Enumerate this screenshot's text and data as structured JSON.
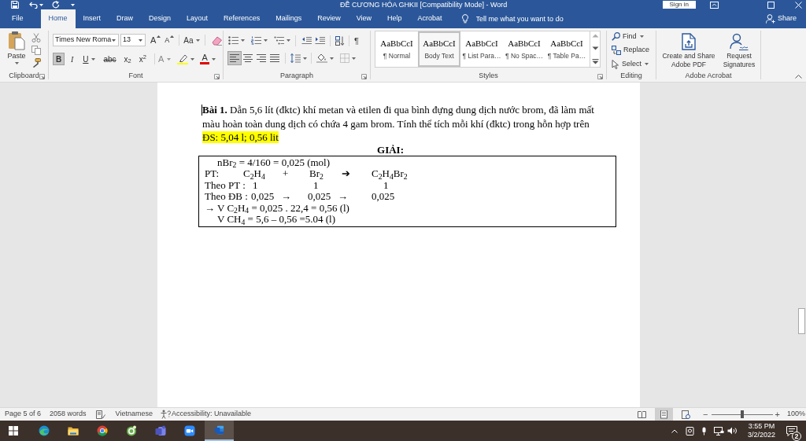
{
  "window": {
    "title": "ĐỀ CƯƠNG HÓA GHKII [Compatibility Mode] - Word",
    "sign_in": "Sign in"
  },
  "tabs": [
    {
      "label": "File",
      "selected": false
    },
    {
      "label": "Home",
      "selected": true
    },
    {
      "label": "Insert",
      "selected": false
    },
    {
      "label": "Draw",
      "selected": false
    },
    {
      "label": "Design",
      "selected": false
    },
    {
      "label": "Layout",
      "selected": false
    },
    {
      "label": "References",
      "selected": false
    },
    {
      "label": "Mailings",
      "selected": false
    },
    {
      "label": "Review",
      "selected": false
    },
    {
      "label": "View",
      "selected": false
    },
    {
      "label": "Help",
      "selected": false
    },
    {
      "label": "Acrobat",
      "selected": false
    }
  ],
  "tell_me": {
    "placeholder": "Tell me what you want to do"
  },
  "share": "Share",
  "ribbon": {
    "clipboard": {
      "paste": "Paste",
      "label": "Clipboard",
      "launcher": true
    },
    "font": {
      "name": "Times New Roma",
      "size": "13",
      "grow": "A",
      "shrink": "A",
      "change_case": "Aa",
      "formats": [
        {
          "kind": "bold",
          "label": "B",
          "selected": true,
          "dropdown": false
        },
        {
          "kind": "italic",
          "label": "I",
          "selected": false,
          "dropdown": false
        },
        {
          "kind": "underline",
          "label": "U",
          "selected": false,
          "dropdown": true
        },
        {
          "kind": "strike",
          "label": "abc",
          "selected": false,
          "dropdown": false
        },
        {
          "kind": "subscript",
          "label": "x$_{2}$",
          "selected": false,
          "dropdown": false
        },
        {
          "kind": "superscript",
          "label": "x$^{2}$",
          "selected": false,
          "dropdown": false
        }
      ],
      "effects": "A",
      "font_color": "A",
      "label": "Font",
      "launcher": true
    },
    "paragraph": {
      "alignment": [
        {
          "kind": "left",
          "selected": true
        },
        {
          "kind": "center",
          "selected": false
        },
        {
          "kind": "right",
          "selected": false
        },
        {
          "kind": "justify",
          "selected": false
        }
      ],
      "marks": "¶",
      "label": "Paragraph",
      "launcher": true
    },
    "styles": {
      "items": [
        {
          "preview": "AaBbCcI",
          "label": "¶ Normal",
          "selected": false
        },
        {
          "preview": "AaBbCcI",
          "label": "Body Text",
          "selected": true
        },
        {
          "preview": "AaBbCcI",
          "label": "¶ List Para…",
          "selected": false
        },
        {
          "preview": "AaBbCcI",
          "label": "¶ No Spac…",
          "selected": false
        },
        {
          "preview": "AaBbCcI",
          "label": "¶ Table Pa…",
          "selected": false
        }
      ],
      "label": "Styles",
      "launcher": true
    },
    "editing": {
      "items": [
        {
          "kind": "find",
          "label": "Find",
          "dropdown": true
        },
        {
          "kind": "replace",
          "label": "Replace",
          "dropdown": false
        },
        {
          "kind": "select",
          "label": "Select",
          "dropdown": true
        }
      ],
      "label": "Editing",
      "launcher": false
    },
    "acrobat": {
      "buttons": [
        {
          "kind": "pdf",
          "lines": [
            "Create and Share",
            "Adobe PDF"
          ]
        },
        {
          "kind": "signatures",
          "lines": [
            "Request",
            "Signatures"
          ]
        }
      ],
      "label": "Adobe Acrobat",
      "launcher": false
    }
  },
  "document": {
    "paragraph": "**Bài 1.** Dẫn 5,6 lít (đktc) khí metan và etilen đi qua bình đựng dung dịch nước brom, đã làm mất màu hoàn toàn dung dịch có chứa 4 gam brom. Tính thể tích mỗi khí (đktc) trong hỗn hợp trên",
    "answer": {
      "text": "ĐS: 5,04 l; 0,56 lit",
      "highlighted": true
    },
    "heading": "GIẢI:",
    "solution": [
      {
        "kind": "indented",
        "cells": [
          "nBr$_{2}$ = 4/160 = 0,025 (mol)"
        ]
      },
      {
        "kind": "equation",
        "cells": [
          "PT:",
          "C$_{2}$H$_{4}$",
          "+",
          "Br$_{2}$",
          "➔",
          "C$_{2}$H$_{4}$Br$_{2}$"
        ]
      },
      {
        "kind": "ratio",
        "cells": [
          "Theo PT :",
          "1",
          "1",
          "1"
        ]
      },
      {
        "kind": "amounts",
        "cells": [
          "Theo ĐB :",
          "0,025",
          "→",
          "0,025",
          "→",
          "0,025"
        ]
      },
      {
        "kind": "line",
        "cells": [
          "→ V C$_{2}$H$_{4}$ = 0,025 . 22,4 = 0,56 (l)"
        ]
      },
      {
        "kind": "indented",
        "cells": [
          "V CH$_{4}$ = 5,6 – 0,56 =5.04 (l)"
        ]
      }
    ]
  },
  "status_bar": {
    "page": "Page 5 of 6",
    "words": "2058 words",
    "language": "Vietnamese",
    "accessibility": "Accessibility: Unavailable",
    "views": [
      {
        "kind": "read",
        "selected": false
      },
      {
        "kind": "print",
        "selected": true
      },
      {
        "kind": "web",
        "selected": false
      }
    ],
    "zoom": {
      "out": "−",
      "in": "+",
      "level": 0.5,
      "reading": "100%"
    }
  },
  "taskbar": {
    "apps": [
      {
        "kind": "swirl",
        "selected": false
      },
      {
        "kind": "folder",
        "selected": false
      },
      {
        "kind": "ring",
        "selected": false
      },
      {
        "kind": "disc",
        "selected": false
      },
      {
        "kind": "people",
        "selected": false
      },
      {
        "kind": "camera",
        "selected": false
      },
      {
        "kind": "document",
        "selected": true
      }
    ],
    "clock": {
      "time": "3:55 PM",
      "date": "3/2/2022"
    },
    "notifications": "2"
  }
}
